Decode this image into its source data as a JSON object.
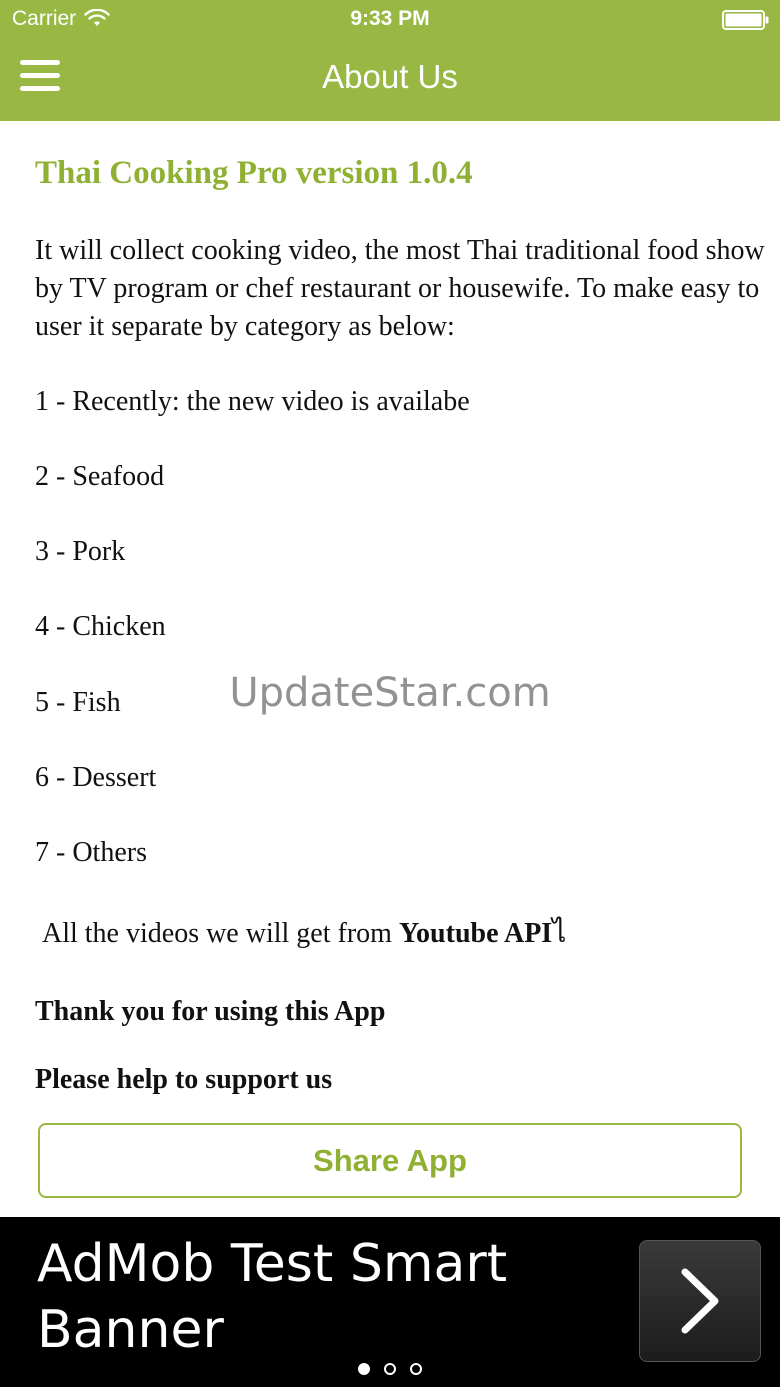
{
  "status_bar": {
    "carrier": "Carrier",
    "time": "9:33 PM"
  },
  "nav": {
    "title": "About Us",
    "menu_icon": "hamburger-menu-icon"
  },
  "content": {
    "app_title": "Thai Cooking Pro version 1.0.4",
    "intro": "It will collect cooking video, the most Thai traditional food show by TV program or chef restaurant or housewife. To make easy to user it separate by category as below:",
    "categories": [
      "1 - Recently: the new video is availabe",
      "2 - Seafood",
      "3 - Pork",
      "4 - Chicken",
      "5 - Fish",
      "6 - Dessert",
      "7 - Others"
    ],
    "videos_note_prefix": "All the videos we will get from ",
    "videos_note_source": "Youtube API",
    "videos_note_suffix": "ไ",
    "thanks": "Thank you for using this App",
    "support": "Please help to support us",
    "share_button": "Share App"
  },
  "watermark": "UpdateStar.com",
  "ad": {
    "text": "AdMob Test Smart Banner",
    "arrow_icon": "chevron-right-icon",
    "pages": 3,
    "active_page": 1
  },
  "colors": {
    "accent": "#98b843",
    "title_green": "#8fb032",
    "ad_background": "#000000"
  }
}
